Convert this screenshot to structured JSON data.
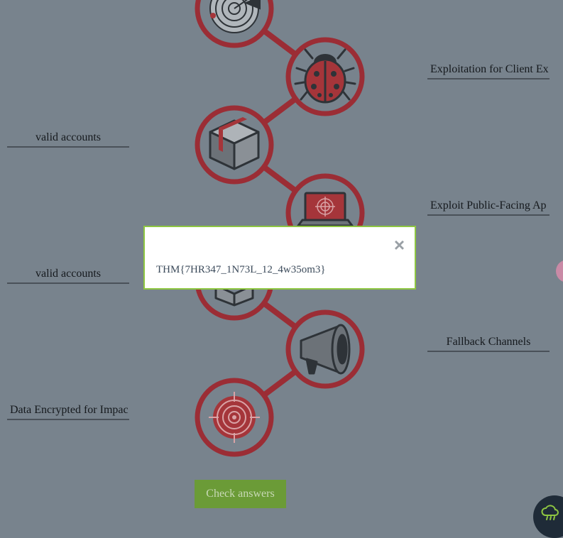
{
  "fields": {
    "right_1": "Exploitation for Client Ex",
    "left_1": "valid accounts",
    "right_2": "Exploit Public-Facing Ap",
    "left_2": "valid accounts",
    "right_3": "Fallback Channels",
    "left_3": "Data Encrypted for Impac"
  },
  "modal": {
    "close_label": "×",
    "flag_text": "THM{7HR347_1N73L_12_4w35om3}"
  },
  "check_button_label": "Check answers",
  "colors": {
    "background": "#78838d",
    "node_ring": "#9b2d35",
    "icon_dark": "#3a3f44",
    "accent_red": "#a5353a",
    "button_green": "#6b9b37",
    "modal_border": "#8ec641"
  },
  "icons": [
    "radar-icon",
    "ladybug-icon",
    "box-icon",
    "laptop-target-icon",
    "megaphone-icon",
    "target-icon"
  ]
}
